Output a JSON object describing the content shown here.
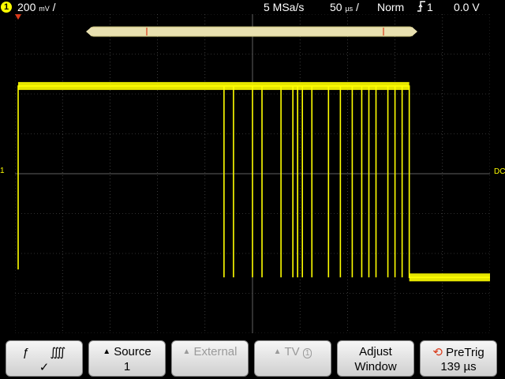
{
  "status": {
    "channel_number": "1",
    "volts_per_div": "200",
    "volts_unit": "mV",
    "sample_rate": "5 MSa/s",
    "time_per_div": "50",
    "time_unit": "µs",
    "trigger_mode": "Norm",
    "trigger_slope_icon": "rising-edge-icon",
    "trigger_source": "1",
    "trigger_level": "0.0 V"
  },
  "markers": {
    "ground_label": "1",
    "right_label": "DC"
  },
  "colors": {
    "trace": "#ffff00",
    "grid": "#606060",
    "accent_red": "#d93a1a"
  },
  "trace": {
    "high_level_div": -2.2,
    "low_level_div": 2.6,
    "start_time_div": 0.0,
    "end_high_time_div": 8.3,
    "pulses_time_div": [
      4.4,
      4.6,
      5.0,
      5.2,
      5.6,
      5.85,
      5.95,
      6.05,
      6.25,
      6.6,
      6.85,
      7.1,
      7.3,
      7.45,
      7.6,
      7.85,
      8.0,
      8.15
    ]
  },
  "softkeys": [
    {
      "line1": "",
      "line2": "✓",
      "icons": [
        "rising-edge-icon",
        "falling-edge-icon"
      ]
    },
    {
      "line1": "Source",
      "line2": "1",
      "arrow": true
    },
    {
      "line1": "External",
      "line2": "",
      "arrow": true,
      "disabled": true
    },
    {
      "line1": "TV",
      "line2": "",
      "arrow": true,
      "disabled": true,
      "badge": "1"
    },
    {
      "line1": "Adjust",
      "line2": "Window"
    },
    {
      "line1": "PreTrig",
      "line2": "139 µs",
      "knob": true
    }
  ]
}
